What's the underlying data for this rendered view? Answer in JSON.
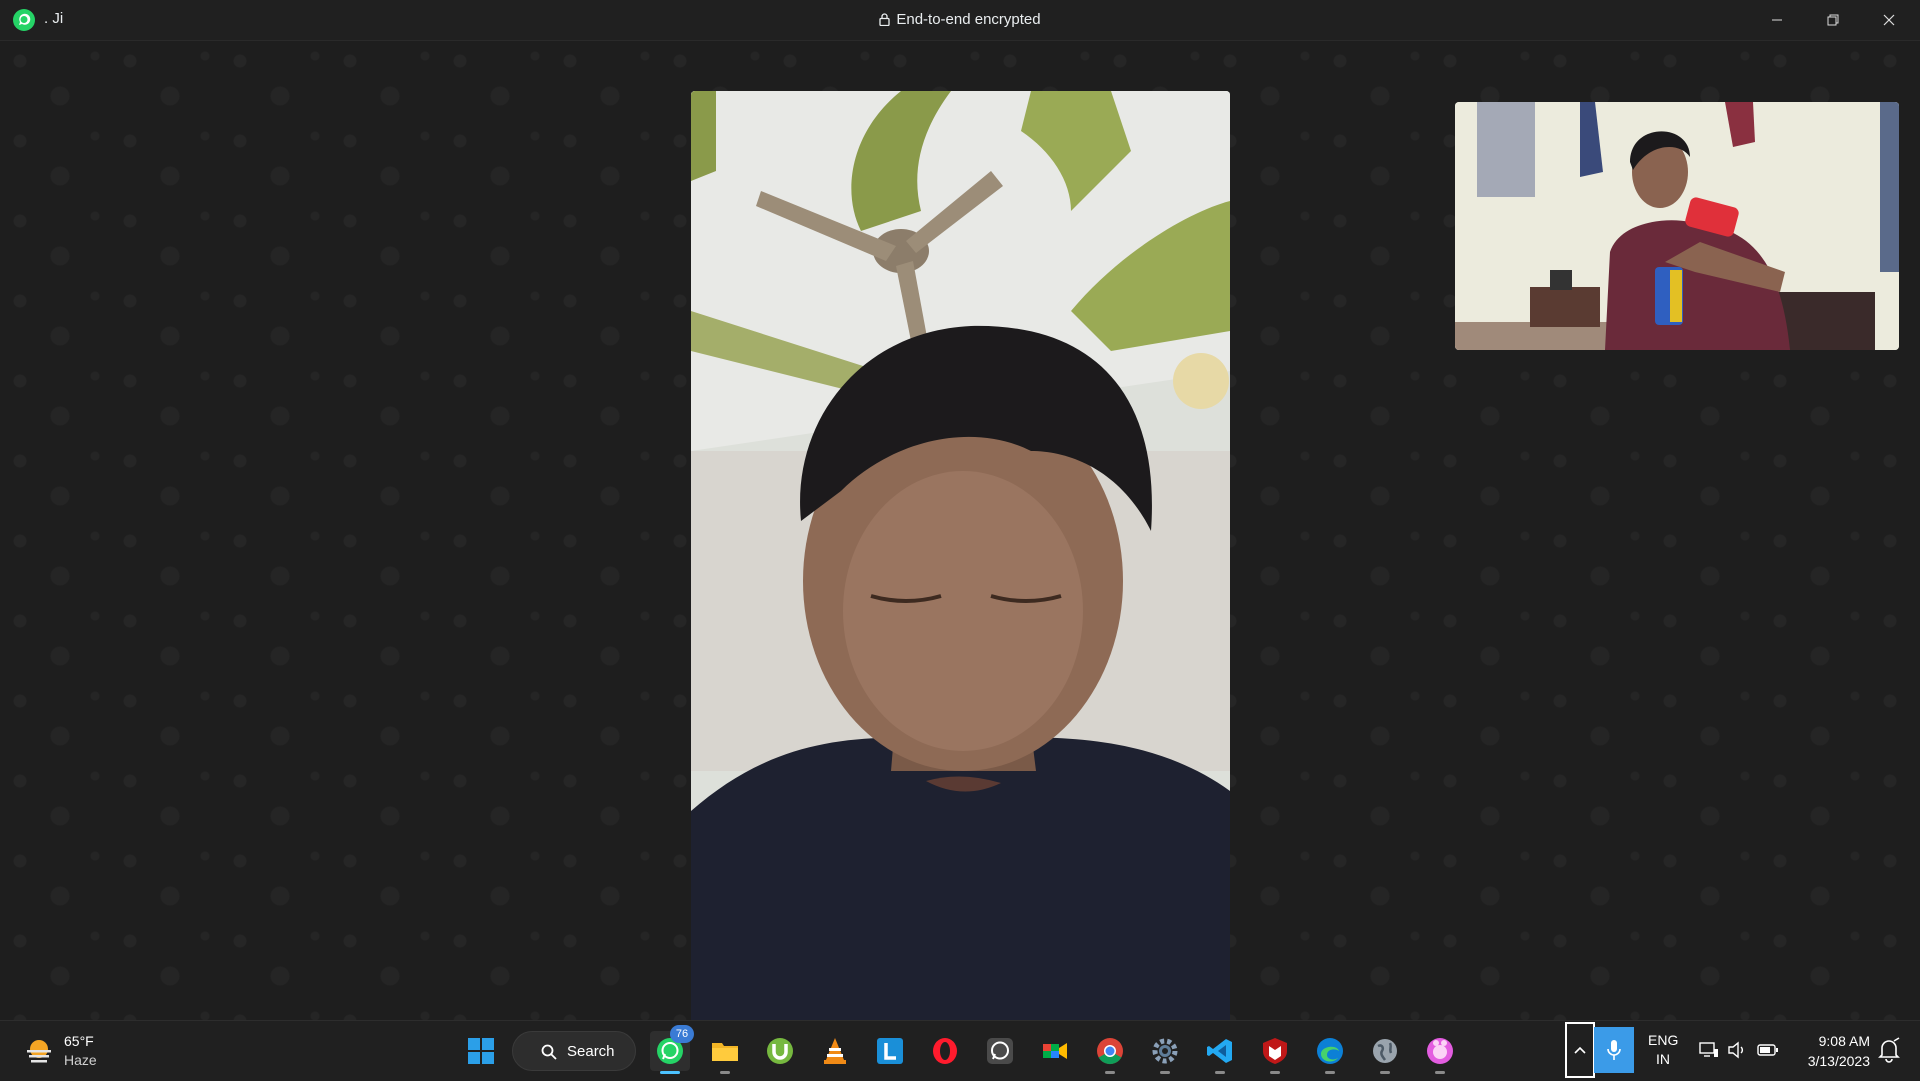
{
  "window": {
    "contact_name": ". Ji",
    "encryption_label": "End-to-end encrypted",
    "controls": [
      "minimize-icon",
      "restore-icon",
      "close-icon"
    ]
  },
  "call": {
    "remote_video": "remote-participant-video",
    "self_video": "self-preview-video"
  },
  "taskbar": {
    "weather": {
      "temperature": "65°F",
      "condition": "Haze"
    },
    "search_label": "Search",
    "apps": [
      {
        "name": "start",
        "icon": "windows-start-icon"
      },
      {
        "name": "search",
        "icon": "search-icon"
      },
      {
        "name": "whatsapp",
        "icon": "whatsapp-icon",
        "badge": "76",
        "active": true
      },
      {
        "name": "file-explorer",
        "icon": "folder-icon"
      },
      {
        "name": "utorrent",
        "icon": "utorrent-icon"
      },
      {
        "name": "vlc",
        "icon": "vlc-cone-icon"
      },
      {
        "name": "l-app",
        "icon": "letter-l-icon",
        "letter": "L"
      },
      {
        "name": "opera",
        "icon": "opera-icon"
      },
      {
        "name": "whatsapp-2",
        "icon": "whatsapp-icon"
      },
      {
        "name": "google-meet",
        "icon": "meet-icon"
      },
      {
        "name": "chrome",
        "icon": "chrome-icon"
      },
      {
        "name": "settings",
        "icon": "gear-icon"
      },
      {
        "name": "vscode",
        "icon": "vscode-icon"
      },
      {
        "name": "mcafee",
        "icon": "mcafee-shield-icon"
      },
      {
        "name": "edge",
        "icon": "edge-icon"
      },
      {
        "name": "browser",
        "icon": "globe-icon"
      },
      {
        "name": "app-pink",
        "icon": "pink-app-icon"
      }
    ],
    "tray": {
      "language_line1": "ENG",
      "language_line2": "IN",
      "time": "9:08 AM",
      "date": "3/13/2023"
    }
  },
  "colors": {
    "titlebar": "#202020",
    "background": "#1e1e1e",
    "whatsapp_green": "#25d366",
    "accent_blue": "#3b9be8"
  }
}
